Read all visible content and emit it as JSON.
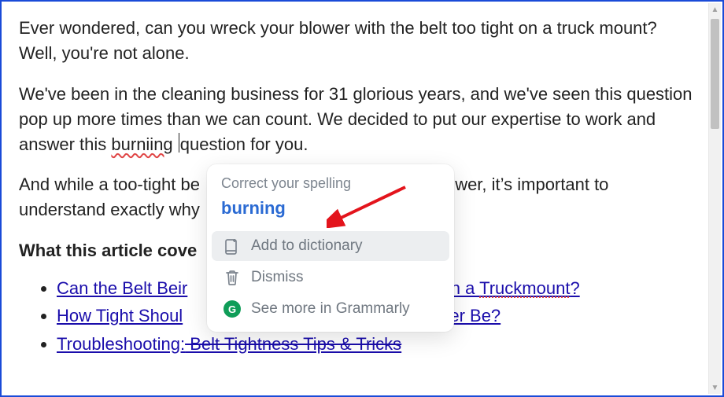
{
  "paragraphs": {
    "p1": "Ever wondered, can you wreck your blower with the belt too tight on a truck mount? Well, you're not alone.",
    "p2_pre": "We've been in the cleaning business for 31 glorious years, and we've seen this question pop up more times than we can count. We decided to put our expertise to work and answer this ",
    "p2_misspell": "burniing",
    "p2_post": "question for you.",
    "p3_pre": "And while a too-tight be",
    "p3_post": "wer, it’s important to understand exactly why",
    "heading": "What this article cove"
  },
  "links": {
    "l1_pre": "Can the Belt Beir",
    "l1_post": "on a ",
    "l1_err": "Truckmount",
    "l1_q": "?",
    "l2_pre": "How Tight Shoul",
    "l2_post": "wer Be?",
    "l3_pre": "Troubleshooting:",
    "l3_post": " Belt Tightness Tips & Tricks"
  },
  "popup": {
    "header": "Correct your spelling",
    "suggestion": "burning",
    "add_to_dict": "Add to dictionary",
    "dismiss": "Dismiss",
    "see_more": "See more in Grammarly",
    "badge_letter": "G"
  },
  "scrollbar": {
    "up": "▲",
    "down": "▼"
  }
}
